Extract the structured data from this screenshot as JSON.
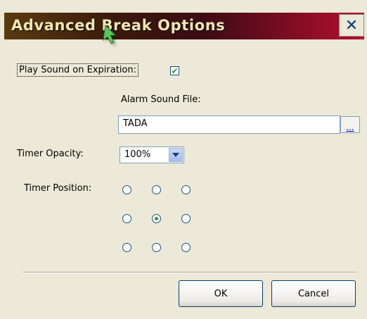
{
  "window": {
    "title": "Advanced Break Options",
    "close_glyph": "✕"
  },
  "sound": {
    "play_label": "Play Sound on Expiration:",
    "play_checked": true,
    "alarm_label": "Alarm Sound File:",
    "alarm_value": "TADA",
    "browse_label": "..."
  },
  "opacity": {
    "label": "Timer Opacity:",
    "value": "100%"
  },
  "position": {
    "label": "Timer Position:",
    "selected": "middle-center"
  },
  "buttons": {
    "ok": "OK",
    "cancel": "Cancel"
  },
  "colors": {
    "dialog_bg": "#ece9d8",
    "title_text": "#f4e8b0",
    "check_mark": "#21a121"
  },
  "icons": {
    "close": "close-icon",
    "checkmark": "checkmark-icon",
    "dropdown": "chevron-down-icon",
    "cursor": "mouse-cursor-icon"
  }
}
